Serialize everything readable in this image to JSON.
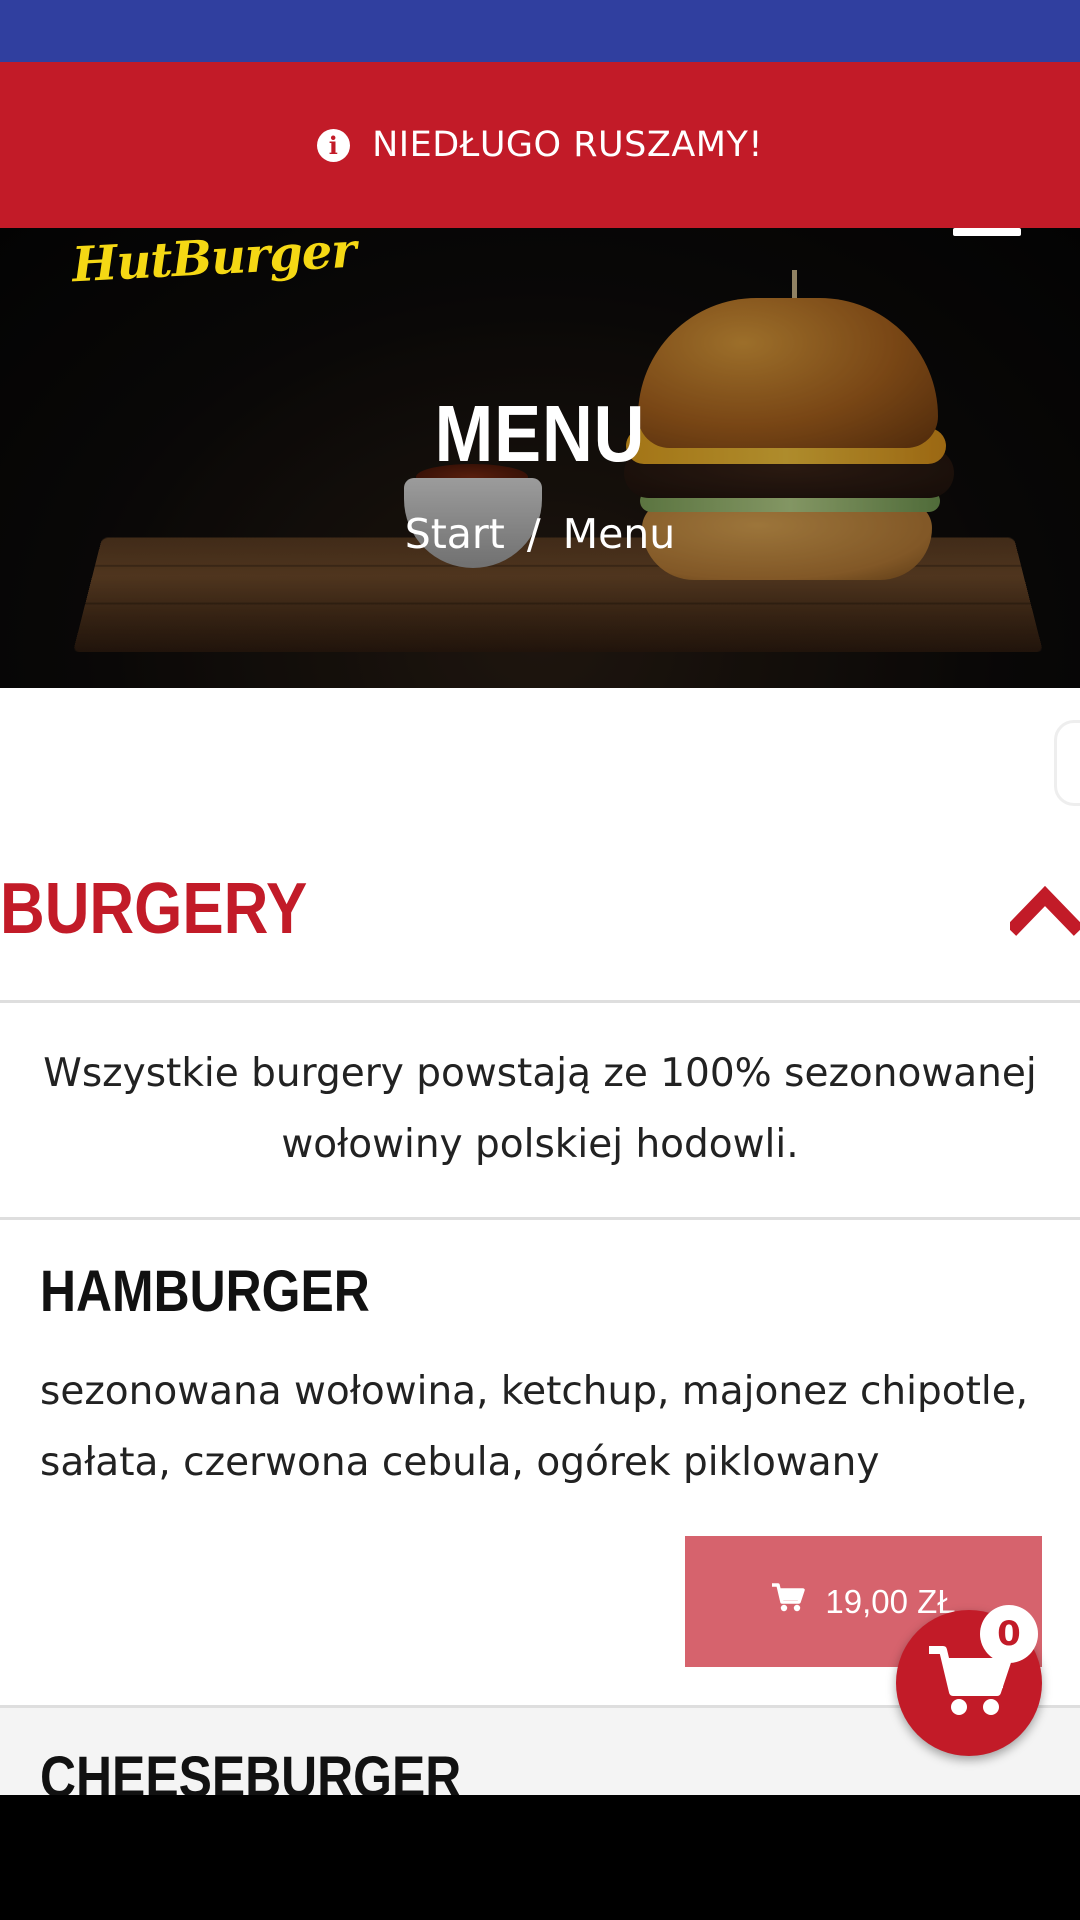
{
  "notice": {
    "text": "NIEDŁUGO RUSZAMY!",
    "icon": "info-icon"
  },
  "header": {
    "logo_text": "HutBurger",
    "menu_icon": "hamburger-menu-icon"
  },
  "hero": {
    "title": "MENU",
    "breadcrumb": {
      "home": "Start",
      "separator": "/",
      "current": "Menu"
    }
  },
  "section": {
    "title": "BURGERY",
    "collapse_icon": "chevron-up-icon",
    "description": "Wszystkie burgery powstają ze 100% sezonowanej wołowiny polskiej hodowli."
  },
  "items": [
    {
      "name": "HAMBURGER",
      "description": "sezonowana wołowina, ketchup, majonez chipotle, sałata, czerwona cebula, ogórek piklowany",
      "price": "19,00 ZŁ",
      "cart_icon": "cart-icon"
    },
    {
      "name": "CHEESEBURGER"
    }
  ],
  "cart": {
    "count": "0",
    "icon": "shopping-cart-icon"
  },
  "colors": {
    "status_bar": "#303f9f",
    "brand_red": "#c21b28",
    "price_button": "#d6636d",
    "logo_yellow": "#f5d814"
  }
}
